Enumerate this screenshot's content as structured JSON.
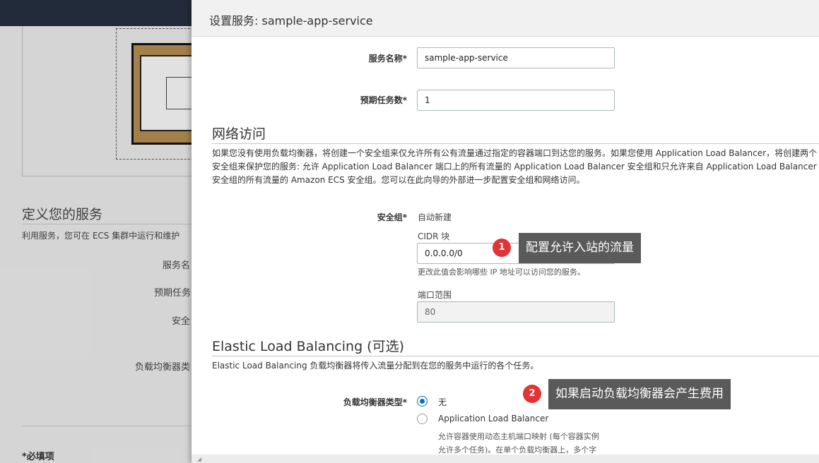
{
  "background": {
    "section_title": "定义您的服务",
    "section_desc": "利用服务，您可在 ECS 集群中运行和维护",
    "labels": [
      "服务名",
      "预期任务",
      "安全",
      "负载均衡器类"
    ],
    "required_note": "*必填项"
  },
  "modal": {
    "title": "设置服务: sample-app-service",
    "service_name": {
      "label": "服务名称*",
      "value": "sample-app-service"
    },
    "desired_tasks": {
      "label": "预期任务数*",
      "value": "1"
    },
    "network": {
      "title": "网络访问",
      "desc": "如果您没有使用负载均衡器，将创建一个安全组来仅允许所有公有流量通过指定的容器端口到达您的服务。如果您使用 Application Load Balancer，将创建两个安全组来保护您的服务: 允许 Application Load Balancer 端口上的所有流量的 Application Load Balancer 安全组和只允许来自 Application Load Balancer 安全组的所有流量的 Amazon ECS 安全组。您可以在此向导的外部进一步配置安全组和网络访问。",
      "security_group": {
        "label": "安全组*",
        "value": "自动新建"
      },
      "cidr": {
        "label": "CIDR 块",
        "value": "0.0.0.0/0",
        "hint": "更改此值会影响哪些 IP 地址可以访问您的服务。"
      },
      "port_range": {
        "label": "端口范围",
        "value": "80"
      }
    },
    "elb": {
      "title": "Elastic Load Balancing (可选)",
      "desc": "Elastic Load Balancing 负载均衡器将传入流量分配到在您的服务中运行的各个任务。",
      "type_label": "负载均衡器类型*",
      "options": [
        {
          "label": "无",
          "selected": true
        },
        {
          "label": "Application Load Balancer",
          "selected": false
        }
      ],
      "alb_desc_line1": "允许容器使用动态主机端口映射 (每个容器实例",
      "alb_desc_line2": "允许多个任务)。在单个负载均衡器上，多个字"
    }
  },
  "annotations": [
    {
      "number": "1",
      "text": "配置允许入站的流量"
    },
    {
      "number": "2",
      "text": "如果启动负载均衡器会产生费用"
    }
  ],
  "colors": {
    "badge": "#e23436",
    "callout": "#5a5a5a",
    "radio_selected": "#0073bb",
    "topbar": "#252f3e"
  }
}
